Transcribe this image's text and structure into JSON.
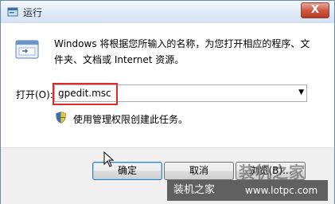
{
  "window": {
    "title": "运行",
    "close_symbol": "X"
  },
  "description": "Windows 将根据您所输入的名称，为您打开相应的程序、文件夹、文档或 Internet 资源。",
  "open_field": {
    "label": "打开(O):",
    "value": "gpedit.msc"
  },
  "admin_note": "使用管理权限创建此任务。",
  "buttons": {
    "ok": "确定",
    "cancel": "取消",
    "browse": "浏览(B)..."
  },
  "watermark": {
    "logo_text": "装机之家",
    "bar_text": "装机之家",
    "url": "www.lotpc.com"
  },
  "colors": {
    "highlight_border": "#e02a2a",
    "close_button": "#c9503b",
    "footer_bg": "#f0f0f0"
  },
  "icons": {
    "title": "run-app-icon",
    "main": "run-program-icon",
    "shield": "uac-shield-icon",
    "cursor": "mouse-cursor-icon"
  }
}
